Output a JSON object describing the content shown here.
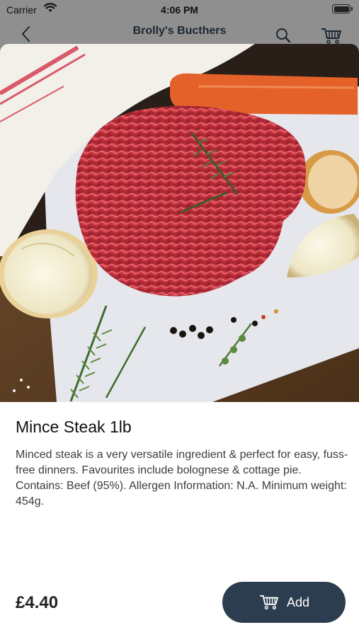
{
  "status_bar": {
    "carrier": "Carrier",
    "time": "4:06 PM"
  },
  "nav": {
    "title": "Brolly's Bucthers",
    "back_icon": "chevron-left-icon",
    "search_icon": "search-icon",
    "cart_icon": "cart-icon"
  },
  "product": {
    "image_icon": "mince-steak-photo",
    "title": "Mince Steak 1lb",
    "description": "Minced steak is a very versatile ingredient & perfect for easy, fuss-free dinners. Favourites include bolognese & cottage pie. Contains: Beef (95%). Allergen Information:  N.A. Minimum weight: 454g.",
    "price": "£4.40",
    "add_label": "Add"
  },
  "colors": {
    "accent": "#2b3d4f",
    "backdrop": "#8f8f8f"
  }
}
